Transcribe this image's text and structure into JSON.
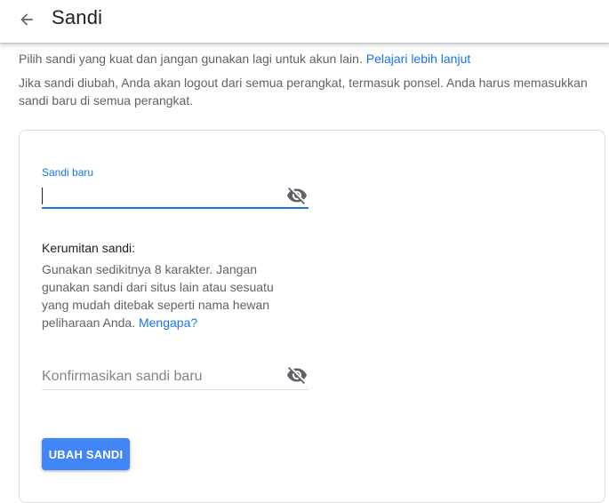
{
  "header": {
    "title": "Sandi",
    "back_icon": "arrow-back-icon"
  },
  "intro": {
    "line1_text": "Pilih sandi yang kuat dan jangan gunakan lagi untuk akun lain.",
    "line1_link": "Pelajari lebih lanjut",
    "line2_text": "Jika sandi diubah, Anda akan logout dari semua perangkat, termasuk ponsel. Anda harus memasukkan sandi baru di semua perangkat."
  },
  "form": {
    "new_password": {
      "label": "Sandi baru",
      "value": "",
      "visibility_icon": "visibility-off-icon"
    },
    "strength": {
      "title": "Kerumitan sandi:",
      "description": "Gunakan sedikitnya 8 karakter. Jangan gunakan sandi dari situs lain atau sesuatu yang mudah ditebak seperti nama hewan peliharaan Anda.",
      "link": "Mengapa?"
    },
    "confirm_password": {
      "placeholder": "Konfirmasikan sandi baru",
      "value": "",
      "visibility_icon": "visibility-off-icon"
    },
    "submit_label": "UBAH SANDI"
  },
  "colors": {
    "accent": "#1a73e8",
    "button": "#4285f4",
    "text_primary": "#202124",
    "text_secondary": "#5f6368",
    "border": "#dadce0"
  }
}
